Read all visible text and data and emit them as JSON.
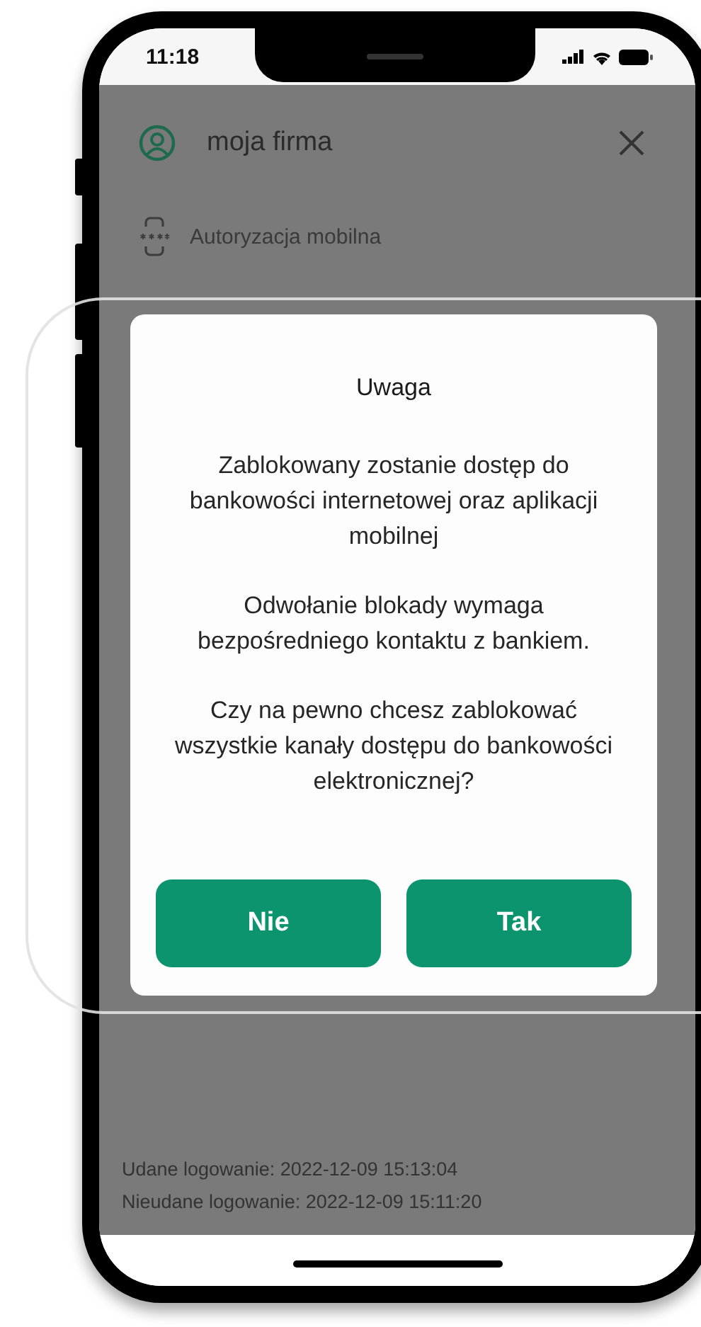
{
  "status_bar": {
    "time": "11:18"
  },
  "header": {
    "title": "moja firma"
  },
  "menu_items": [
    {
      "label": "Autoryzacja mobilna"
    }
  ],
  "dialog": {
    "title": "Uwaga",
    "paragraphs": [
      "Zablokowany zostanie dostęp do bankowości internetowej oraz aplikacji mobilnej",
      "Odwołanie blokady wymaga bezpośredniego kontaktu z bankiem.",
      "Czy na pewno chcesz zablokować wszystkie kanały dostępu do bankowości elektronicznej?"
    ],
    "buttons": [
      {
        "label": "Nie"
      },
      {
        "label": "Tak"
      }
    ]
  },
  "login_info": [
    "Udane logowanie: 2022-12-09 15:13:04",
    "Nieudane logowanie: 2022-12-09 15:11:20"
  ]
}
